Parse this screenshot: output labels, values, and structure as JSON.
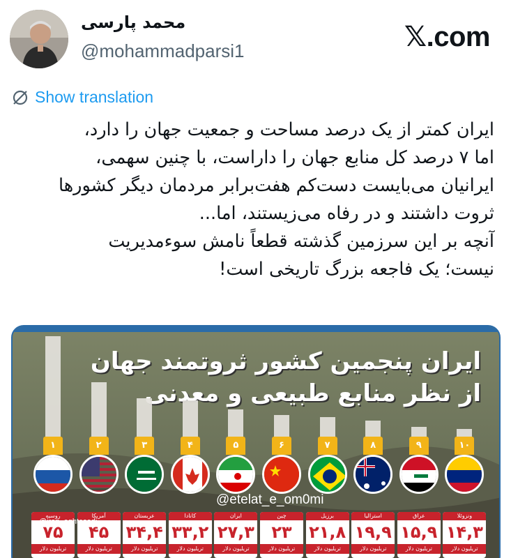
{
  "author": {
    "name": "محمد پارسی",
    "handle": "@mohammadparsi1"
  },
  "brand": {
    "x_glyph": "𝕏",
    "label": ".com"
  },
  "translation": {
    "label": "Show translation",
    "icon": "globe-slash-icon"
  },
  "tweet": {
    "lines": [
      "ایران کمتر از یک درصد مساحت و جمعیت جهان را دارد،",
      "اما ۷ درصد کل منابع جهان را داراست، با چنین سهمی،",
      "ایرانیان می‌بایست دست‌کم هفت‌برابر مردمان دیگر کشورها",
      "ثروت داشتند و در رفاه می‌زیستند، اما...",
      " آنچه بر این سرزمین گذشته قطعاً نامش سوءمدیریت",
      "نیست؛ یک فاجعه بزرگ تاریخی است!"
    ]
  },
  "media": {
    "headline_1": "ایران پنجمین کشور ثروتمند جهان",
    "headline_2": "از نظر منابع طبیعی و معدنی",
    "watermark_1": "@etelat_e_om0mi",
    "watermark_2": "@iran_eghtesadi",
    "unit": "تریلیون دلار",
    "countries": [
      {
        "rank": "۱",
        "name": "روسیه",
        "value": "۷۵",
        "flag": "russia"
      },
      {
        "rank": "۲",
        "name": "آمریکا",
        "value": "۴۵",
        "flag": "usa"
      },
      {
        "rank": "۳",
        "name": "عربستان",
        "value": "۳۴,۴",
        "flag": "saudi"
      },
      {
        "rank": "۴",
        "name": "کانادا",
        "value": "۳۳,۲",
        "flag": "canada"
      },
      {
        "rank": "۵",
        "name": "ایران",
        "value": "۲۷,۳",
        "flag": "iran"
      },
      {
        "rank": "۶",
        "name": "چین",
        "value": "۲۳",
        "flag": "china"
      },
      {
        "rank": "۷",
        "name": "برزیل",
        "value": "۲۱,۸",
        "flag": "brazil"
      },
      {
        "rank": "۸",
        "name": "استرالیا",
        "value": "۱۹,۹",
        "flag": "australia"
      },
      {
        "rank": "۹",
        "name": "عراق",
        "value": "۱۵,۹",
        "flag": "iraq"
      },
      {
        "rank": "۱۰",
        "name": "ونزوئلا",
        "value": "۱۴,۳",
        "flag": "venezuela"
      }
    ],
    "bar_levels": [
      1.0,
      0.6,
      0.46,
      0.44,
      0.36,
      0.31,
      0.29,
      0.26,
      0.21,
      0.19
    ]
  },
  "colors": {
    "link": "#1d9bf0",
    "muted": "#536471",
    "card_red": "#c8232c",
    "rank_gold": "#f2b418"
  }
}
